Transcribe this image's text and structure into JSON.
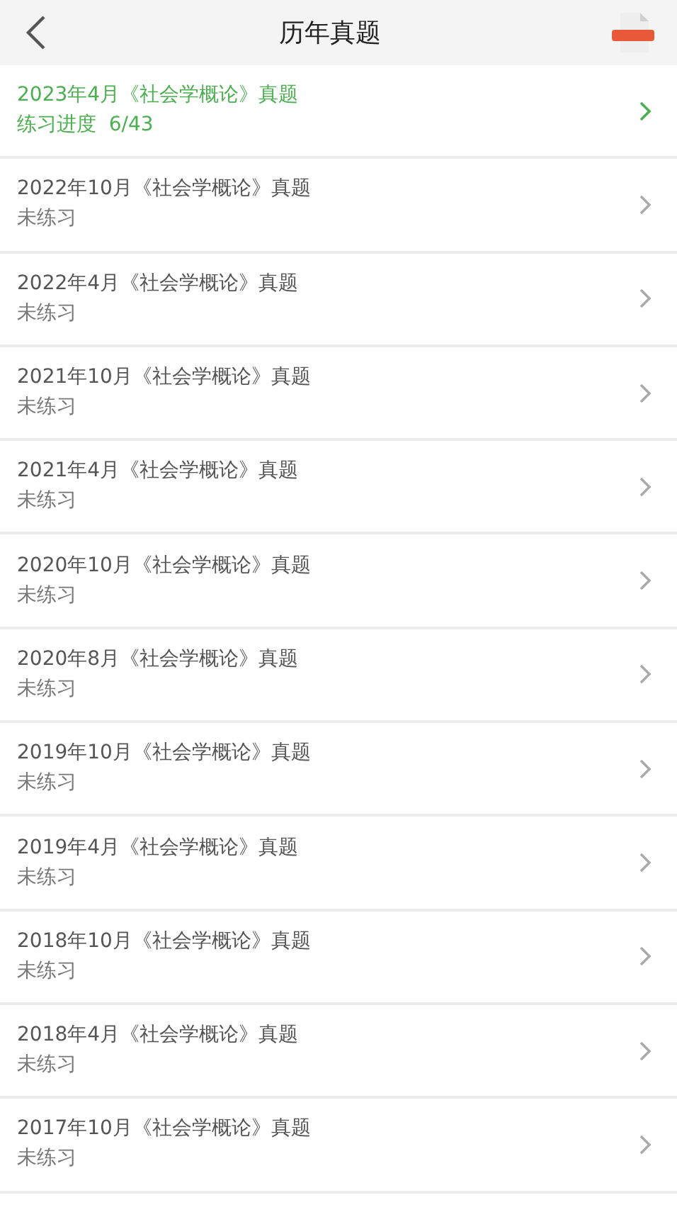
{
  "header": {
    "title": "历年真题"
  },
  "papers": [
    {
      "title": "2023年4月《社会学概论》真题",
      "status": "练习进度  6/43",
      "practiced": true
    },
    {
      "title": "2022年10月《社会学概论》真题",
      "status": "未练习",
      "practiced": false
    },
    {
      "title": "2022年4月《社会学概论》真题",
      "status": "未练习",
      "practiced": false
    },
    {
      "title": "2021年10月《社会学概论》真题",
      "status": "未练习",
      "practiced": false
    },
    {
      "title": "2021年4月《社会学概论》真题",
      "status": "未练习",
      "practiced": false
    },
    {
      "title": "2020年10月《社会学概论》真题",
      "status": "未练习",
      "practiced": false
    },
    {
      "title": "2020年8月《社会学概论》真题",
      "status": "未练习",
      "practiced": false
    },
    {
      "title": "2019年10月《社会学概论》真题",
      "status": "未练习",
      "practiced": false
    },
    {
      "title": "2019年4月《社会学概论》真题",
      "status": "未练习",
      "practiced": false
    },
    {
      "title": "2018年10月《社会学概论》真题",
      "status": "未练习",
      "practiced": false
    },
    {
      "title": "2018年4月《社会学概论》真题",
      "status": "未练习",
      "practiced": false
    },
    {
      "title": "2017年10月《社会学概论》真题",
      "status": "未练习",
      "practiced": false
    }
  ]
}
